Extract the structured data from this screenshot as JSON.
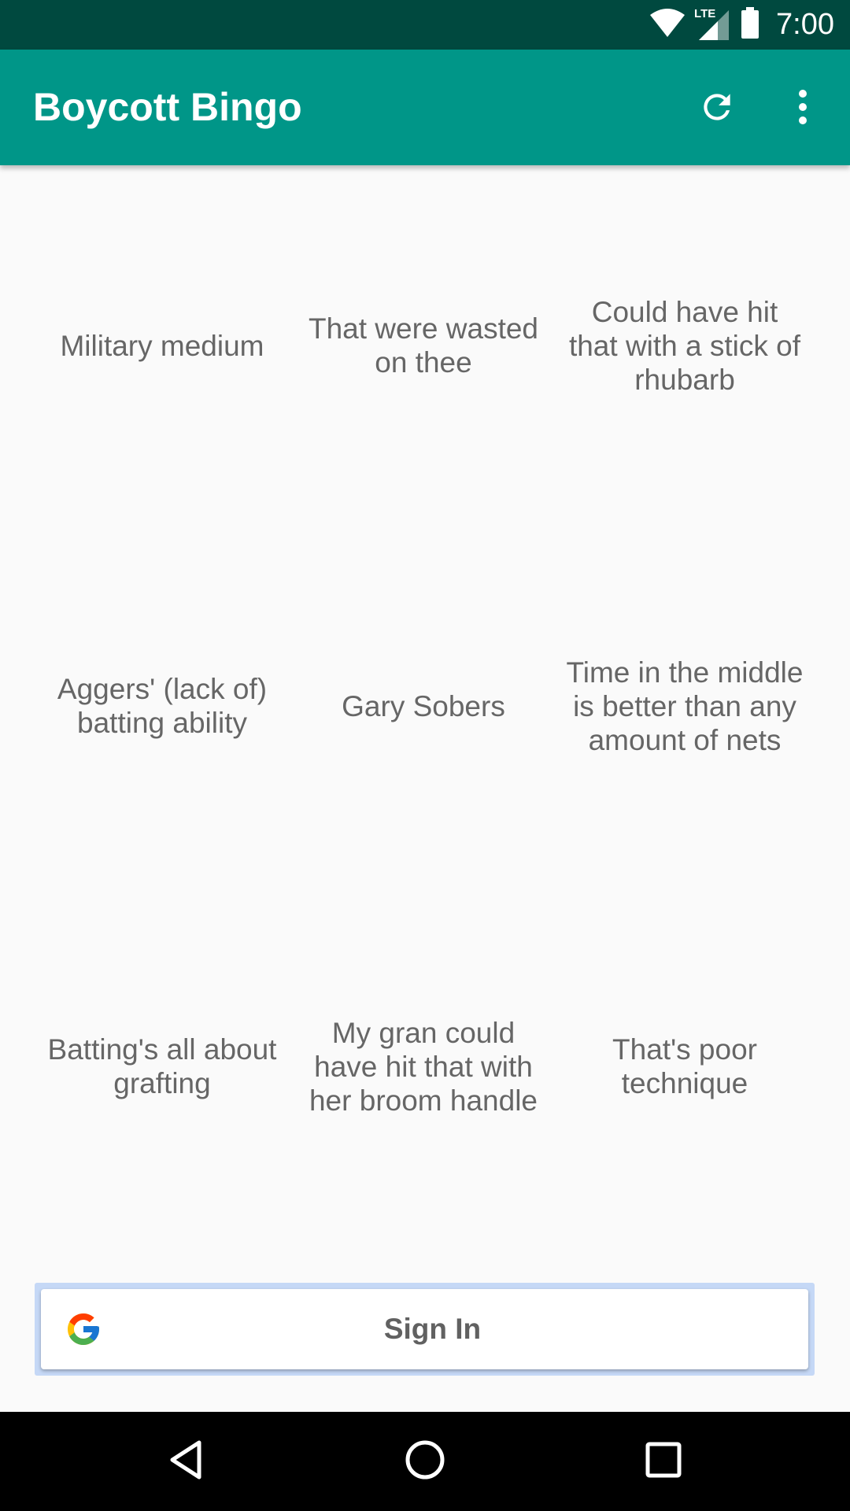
{
  "status_bar": {
    "time": "7:00",
    "network_label": "LTE",
    "icons": [
      "wifi-icon",
      "cell-signal-icon",
      "battery-icon"
    ]
  },
  "app_bar": {
    "title": "Boycott Bingo",
    "actions": [
      "refresh-icon",
      "overflow-menu-icon"
    ],
    "color": "#009688"
  },
  "grid": {
    "cells": [
      "Military medium",
      "That were wasted on thee",
      "Could have hit that with a stick of rhubarb",
      "Aggers' (lack of) batting ability",
      "Gary Sobers",
      "Time in the middle is better than any amount of nets",
      "Batting's all about grafting",
      "My gran could have hit that with her broom handle",
      "That's poor technique"
    ]
  },
  "sign_in": {
    "label": "Sign In",
    "icon": "google-icon"
  },
  "nav_bar": {
    "buttons": [
      "back-icon",
      "home-icon",
      "recents-icon"
    ]
  },
  "colors": {
    "status_bar": "#00493f",
    "app_bar": "#009688",
    "background": "#fafafa",
    "cell_text": "#666666"
  }
}
